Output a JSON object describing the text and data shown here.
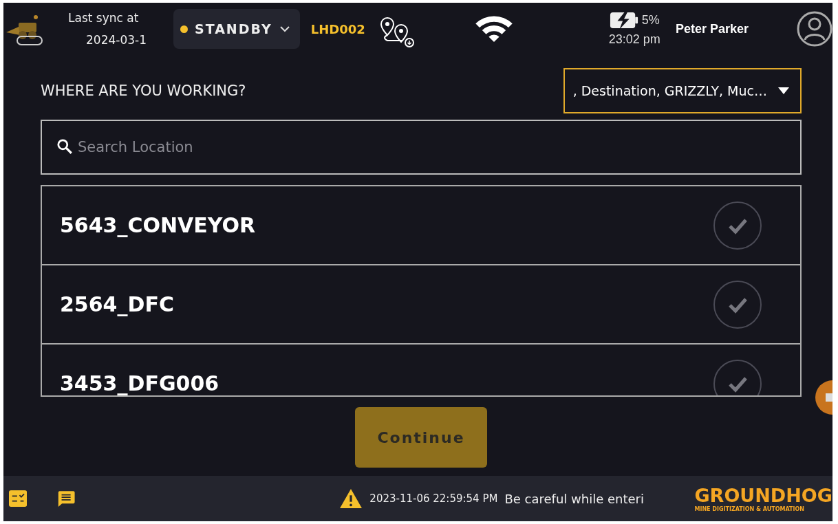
{
  "header": {
    "sync_label": "Last sync at",
    "sync_date": "2024-03-1",
    "status": {
      "label": "STANDBY",
      "color": "#f5c02c"
    },
    "vehicle": "LHD002",
    "battery": "5%",
    "time": "23:02 pm",
    "user": "Peter Parker"
  },
  "prompt": "WHERE ARE YOU WORKING?",
  "filter": {
    "value": ", Destination, GRIZZLY, Muc…"
  },
  "search": {
    "placeholder": "Search Location"
  },
  "locations": [
    {
      "name": "5643_CONVEYOR",
      "selected": false
    },
    {
      "name": "2564_DFC",
      "selected": false
    },
    {
      "name": "3453_DFG006",
      "selected": false
    }
  ],
  "continue_button": {
    "label": "Continue",
    "disabled": true
  },
  "footer": {
    "alert_time": "2023-11-06 22:59:54 PM",
    "alert_text": "Be careful while enteri",
    "brand": "GROUNDHOG",
    "tagline": "MINE DIGITIZATION & AUTOMATION"
  }
}
